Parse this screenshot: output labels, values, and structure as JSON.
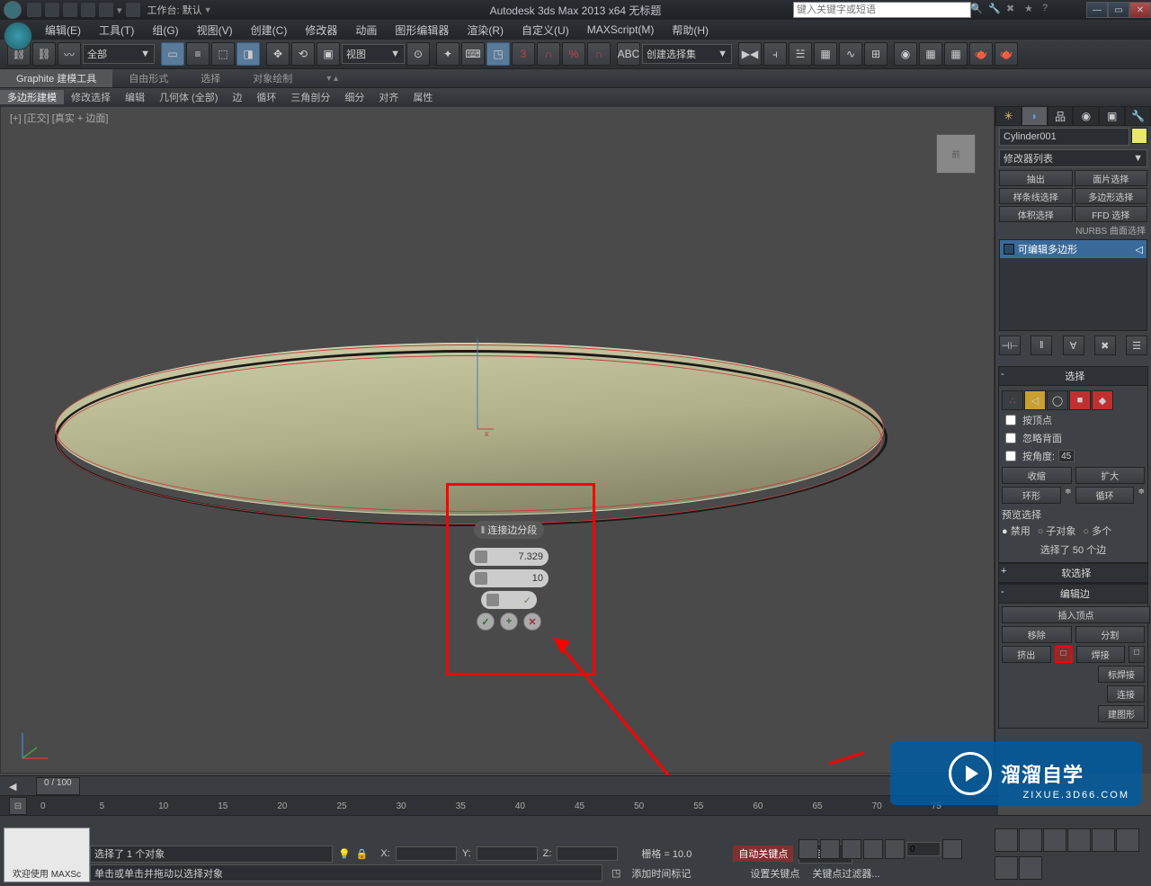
{
  "titlebar": {
    "workspace_label": "工作台: 默认",
    "app_title": "Autodesk 3ds Max  2013 x64     无标题",
    "search_placeholder": "键入关键字或短语",
    "min": "—",
    "max": "▭",
    "close": "✕"
  },
  "menubar": {
    "items": [
      "编辑(E)",
      "工具(T)",
      "组(G)",
      "视图(V)",
      "创建(C)",
      "修改器",
      "动画",
      "图形编辑器",
      "渲染(R)",
      "自定义(U)",
      "MAXScript(M)",
      "帮助(H)"
    ]
  },
  "maintoolbar": {
    "sel_filter": "全部",
    "ref_coord": "视图",
    "named_sel": "创建选择集"
  },
  "ribbon": {
    "tabs": [
      "Graphite 建模工具",
      "自由形式",
      "选择",
      "对象绘制"
    ],
    "row2": [
      "多边形建模",
      "修改选择",
      "编辑",
      "几何体 (全部)",
      "边",
      "循环",
      "三角剖分",
      "细分",
      "对齐",
      "属性"
    ]
  },
  "viewport": {
    "label": "[+] [正交] [真实 + 边面]",
    "cube_face": "前"
  },
  "caddy": {
    "title": "‖ 连接边分段",
    "field1": "7.329",
    "field2": "10",
    "ok": "✓",
    "plus": "+",
    "cancel": "✕"
  },
  "cmdpanel": {
    "object_name": "Cylinder001",
    "modifier_list": "修改器列表",
    "buttons_row1": [
      "抽出",
      "面片选择"
    ],
    "buttons_row2": [
      "样条线选择",
      "多边形选择"
    ],
    "buttons_row3": [
      "体积选择",
      "FFD 选择"
    ],
    "nurbs_label": "NURBS 曲面选择",
    "stack_item": "可编辑多边形",
    "rollout_select": "选择",
    "chk_by_vertex": "按顶点",
    "chk_ignore_back": "忽略背面",
    "chk_by_angle": "按角度:",
    "angle_value": "45.0",
    "shrink": "收缩",
    "grow": "扩大",
    "ring": "环形",
    "loop": "循环",
    "preview_label": "预览选择",
    "preview_opts": [
      "禁用",
      "子对象",
      "多个"
    ],
    "selection_info": "选择了 50 个边",
    "rollout_soft": "软选择",
    "rollout_edit_edge": "编辑边",
    "insert_vertex": "插入顶点",
    "remove": "移除",
    "split": "分割",
    "extrude": "挤出",
    "weld": "焊接",
    "target_weld": "标焊接",
    "chamfer": "连接",
    "create_shape": "建图形"
  },
  "timeslider": {
    "frame": "0 / 100"
  },
  "statusbar": {
    "welcome": "欢迎使用  MAXSc",
    "prompt1": "选择了 1 个对象",
    "prompt2": "单击或单击并拖动以选择对象",
    "x_label": "X:",
    "y_label": "Y:",
    "z_label": "Z:",
    "grid_label": "栅格 = 10.0",
    "add_time_tag": "添加时间标记",
    "auto_key": "自动关键点",
    "set_key": "设置关键点",
    "sel_combo": "选定对",
    "key_filters": "关键点过滤器...",
    "frame_spin": "0"
  },
  "watermark": {
    "brand": "溜溜自学",
    "url": "ZIXUE.3D66.COM"
  }
}
